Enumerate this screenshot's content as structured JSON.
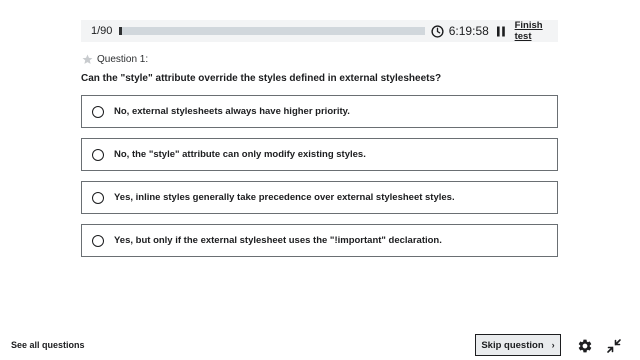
{
  "header": {
    "counter": "1/90",
    "progress": 0.011,
    "timer": "6:19:58",
    "finish_label": "Finish test",
    "icons": {
      "timer": "clock-icon",
      "pause": "pause-icon"
    }
  },
  "question": {
    "label": "Question 1:",
    "text": "Can the \"style\" attribute override the styles defined in external stylesheets?"
  },
  "answers": [
    {
      "text": "No, external stylesheets always have higher priority."
    },
    {
      "text": "No, the \"style\" attribute can only modify existing styles."
    },
    {
      "text": "Yes, inline styles generally take precedence over external stylesheet styles."
    },
    {
      "text": "Yes, but only if the external stylesheet uses the \"!important\" declaration."
    }
  ],
  "footer": {
    "see_all_label": "See all questions",
    "skip_label": "Skip question",
    "icons": {
      "settings": "gear-icon",
      "expand": "expand-icon"
    }
  }
}
